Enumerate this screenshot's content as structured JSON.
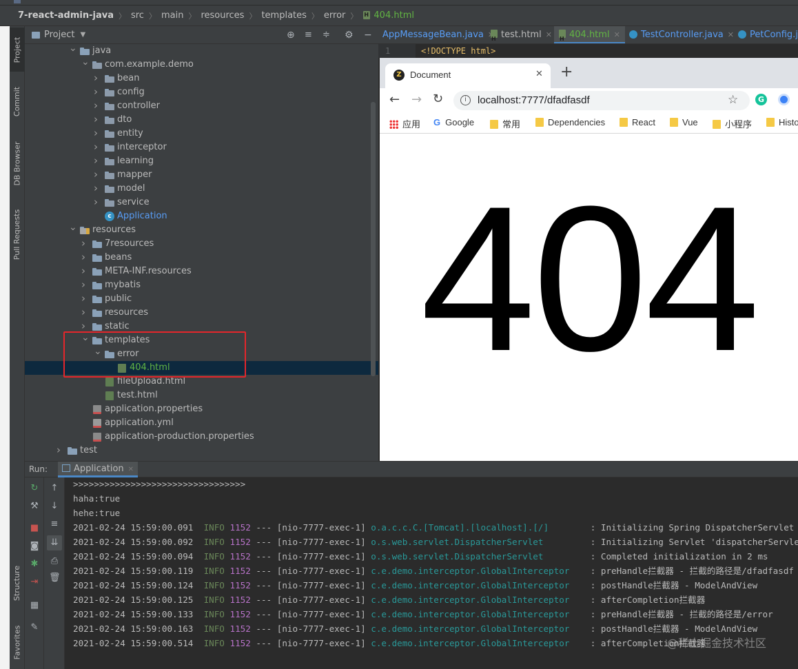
{
  "breadcrumb": {
    "items": [
      "7-react-admin-java",
      "src",
      "main",
      "resources",
      "templates",
      "error"
    ],
    "file": "404.html"
  },
  "toolwindows": {
    "left_top": [
      "Project",
      "Commit",
      "DB Browser",
      "Pull Requests"
    ],
    "left_bottom": [
      "Structure",
      "Favorites"
    ]
  },
  "project_panel": {
    "title": "Project",
    "tree": [
      {
        "label": "java",
        "type": "folder-src",
        "depth": 3,
        "expanded": true
      },
      {
        "label": "com.example.demo",
        "type": "package",
        "depth": 4,
        "expanded": true
      },
      {
        "label": "bean",
        "type": "package",
        "depth": 5,
        "expanded": false
      },
      {
        "label": "config",
        "type": "package",
        "depth": 5,
        "expanded": false
      },
      {
        "label": "controller",
        "type": "package",
        "depth": 5,
        "expanded": false
      },
      {
        "label": "dto",
        "type": "package",
        "depth": 5,
        "expanded": false
      },
      {
        "label": "entity",
        "type": "package",
        "depth": 5,
        "expanded": false
      },
      {
        "label": "interceptor",
        "type": "package",
        "depth": 5,
        "expanded": false
      },
      {
        "label": "learning",
        "type": "package",
        "depth": 5,
        "expanded": false
      },
      {
        "label": "mapper",
        "type": "package",
        "depth": 5,
        "expanded": false
      },
      {
        "label": "model",
        "type": "package",
        "depth": 5,
        "expanded": false
      },
      {
        "label": "service",
        "type": "package",
        "depth": 5,
        "expanded": false
      },
      {
        "label": "Application",
        "type": "class",
        "depth": 5
      },
      {
        "label": "resources",
        "type": "folder-res",
        "depth": 3,
        "expanded": true
      },
      {
        "label": "7resources",
        "type": "folder",
        "depth": 4,
        "expanded": false
      },
      {
        "label": "beans",
        "type": "folder",
        "depth": 4,
        "expanded": false
      },
      {
        "label": "META-INF.resources",
        "type": "folder",
        "depth": 4,
        "expanded": false
      },
      {
        "label": "mybatis",
        "type": "folder",
        "depth": 4,
        "expanded": false
      },
      {
        "label": "public",
        "type": "folder",
        "depth": 4,
        "expanded": false
      },
      {
        "label": "resources",
        "type": "folder",
        "depth": 4,
        "expanded": false
      },
      {
        "label": "static",
        "type": "folder",
        "depth": 4,
        "expanded": false
      },
      {
        "label": "templates",
        "type": "folder",
        "depth": 4,
        "expanded": true
      },
      {
        "label": "error",
        "type": "folder",
        "depth": 5,
        "expanded": true
      },
      {
        "label": "404.html",
        "type": "html",
        "depth": 6,
        "selected": true
      },
      {
        "label": "fileUpload.html",
        "type": "html",
        "depth": 5
      },
      {
        "label": "test.html",
        "type": "html",
        "depth": 5
      },
      {
        "label": "application.properties",
        "type": "props",
        "depth": 4
      },
      {
        "label": "application.yml",
        "type": "yml",
        "depth": 4
      },
      {
        "label": "application-production.properties",
        "type": "props",
        "depth": 4
      },
      {
        "label": "test",
        "type": "folder",
        "depth": 2,
        "expanded": false
      }
    ]
  },
  "editor": {
    "tabs": [
      {
        "label": "AppMessageBean.java",
        "icon": "none",
        "active": false
      },
      {
        "label": "test.html",
        "icon": "html",
        "active": false
      },
      {
        "label": "404.html",
        "icon": "html",
        "active": true
      },
      {
        "label": "TestController.java",
        "icon": "class",
        "active": false
      },
      {
        "label": "PetConfig.jav",
        "icon": "class",
        "active": false
      }
    ],
    "line_number": "1",
    "code": "<!DOCTYPE html>"
  },
  "browser": {
    "tab_title": "Document",
    "url": "localhost:7777/dfadfasdf",
    "bookmarks": [
      "应用",
      "Google",
      "常用",
      "Dependencies",
      "React",
      "Vue",
      "小程序",
      "Histo"
    ],
    "page_text": "404"
  },
  "run_panel": {
    "run_label": "Run:",
    "tab_label": "Application",
    "lines": [
      {
        "plain": ">>>>>>>>>>>>>>>>>>>>>>>>>>>>>>>>>"
      },
      {
        "plain": "haha:true"
      },
      {
        "plain": "hehe:true"
      },
      {
        "ts": "2021-02-24 15:59:00.091",
        "level": "INFO",
        "pid": "1152",
        "thread": "--- [nio-7777-exec-1]",
        "logger": "o.a.c.c.C.[Tomcat].[localhost].[/]       ",
        "msg": ": Initializing Spring DispatcherServlet"
      },
      {
        "ts": "2021-02-24 15:59:00.092",
        "level": "INFO",
        "pid": "1152",
        "thread": "--- [nio-7777-exec-1]",
        "logger": "o.s.web.servlet.DispatcherServlet        ",
        "msg": ": Initializing Servlet 'dispatcherServlet'"
      },
      {
        "ts": "2021-02-24 15:59:00.094",
        "level": "INFO",
        "pid": "1152",
        "thread": "--- [nio-7777-exec-1]",
        "logger": "o.s.web.servlet.DispatcherServlet        ",
        "msg": ": Completed initialization in 2 ms"
      },
      {
        "ts": "2021-02-24 15:59:00.119",
        "level": "INFO",
        "pid": "1152",
        "thread": "--- [nio-7777-exec-1]",
        "logger": "c.e.demo.interceptor.GlobalInterceptor   ",
        "msg": ": preHandle拦截器 - 拦截的路径是/dfadfasdf"
      },
      {
        "ts": "2021-02-24 15:59:00.124",
        "level": "INFO",
        "pid": "1152",
        "thread": "--- [nio-7777-exec-1]",
        "logger": "c.e.demo.interceptor.GlobalInterceptor   ",
        "msg": ": postHandle拦截器 - ModelAndView"
      },
      {
        "ts": "2021-02-24 15:59:00.125",
        "level": "INFO",
        "pid": "1152",
        "thread": "--- [nio-7777-exec-1]",
        "logger": "c.e.demo.interceptor.GlobalInterceptor   ",
        "msg": ": afterCompletion拦截器"
      },
      {
        "ts": "2021-02-24 15:59:00.133",
        "level": "INFO",
        "pid": "1152",
        "thread": "--- [nio-7777-exec-1]",
        "logger": "c.e.demo.interceptor.GlobalInterceptor   ",
        "msg": ": preHandle拦截器 - 拦截的路径是/error"
      },
      {
        "ts": "2021-02-24 15:59:00.163",
        "level": "INFO",
        "pid": "1152",
        "thread": "--- [nio-7777-exec-1]",
        "logger": "c.e.demo.interceptor.GlobalInterceptor   ",
        "msg": ": postHandle拦截器 - ModelAndView"
      },
      {
        "ts": "2021-02-24 15:59:00.514",
        "level": "INFO",
        "pid": "1152",
        "thread": "--- [nio-7777-exec-1]",
        "logger": "c.e.demo.interceptor.GlobalInterceptor   ",
        "msg": ": afterCompletion拦截器"
      }
    ]
  },
  "watermark": "@稀土掘金技术社区",
  "colors": {
    "highlight_box": "#e5262b",
    "info": "#6a8759",
    "pid": "#b873c9",
    "logger": "#299999",
    "file_green": "#62b543"
  }
}
